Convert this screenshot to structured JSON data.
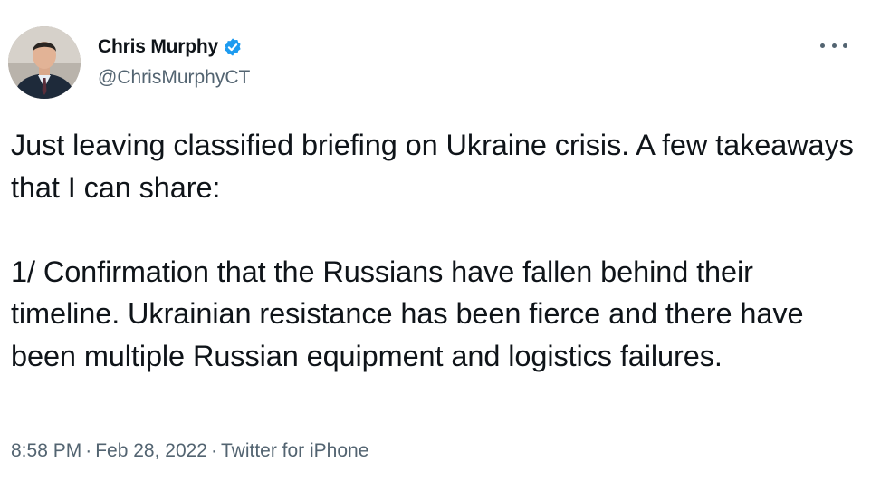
{
  "author": {
    "display_name": "Chris Murphy",
    "handle": "@ChrisMurphyCT",
    "verified_icon": "verified-badge-icon",
    "avatar_icon": "profile-photo"
  },
  "tweet": {
    "paragraphs": [
      "Just leaving classified briefing on Ukraine crisis. A few takeaways that I can share:",
      "1/ Confirmation that the Russians have fallen behind their timeline. Ukrainian resistance has been fierce and there have been multiple Russian equipment and logistics failures."
    ],
    "time": "8:58 PM",
    "date": "Feb 28, 2022",
    "source": "Twitter for iPhone",
    "separator": "·"
  },
  "colors": {
    "text": "#0f1419",
    "secondary": "#536471",
    "verified": "#1d9bf0"
  }
}
